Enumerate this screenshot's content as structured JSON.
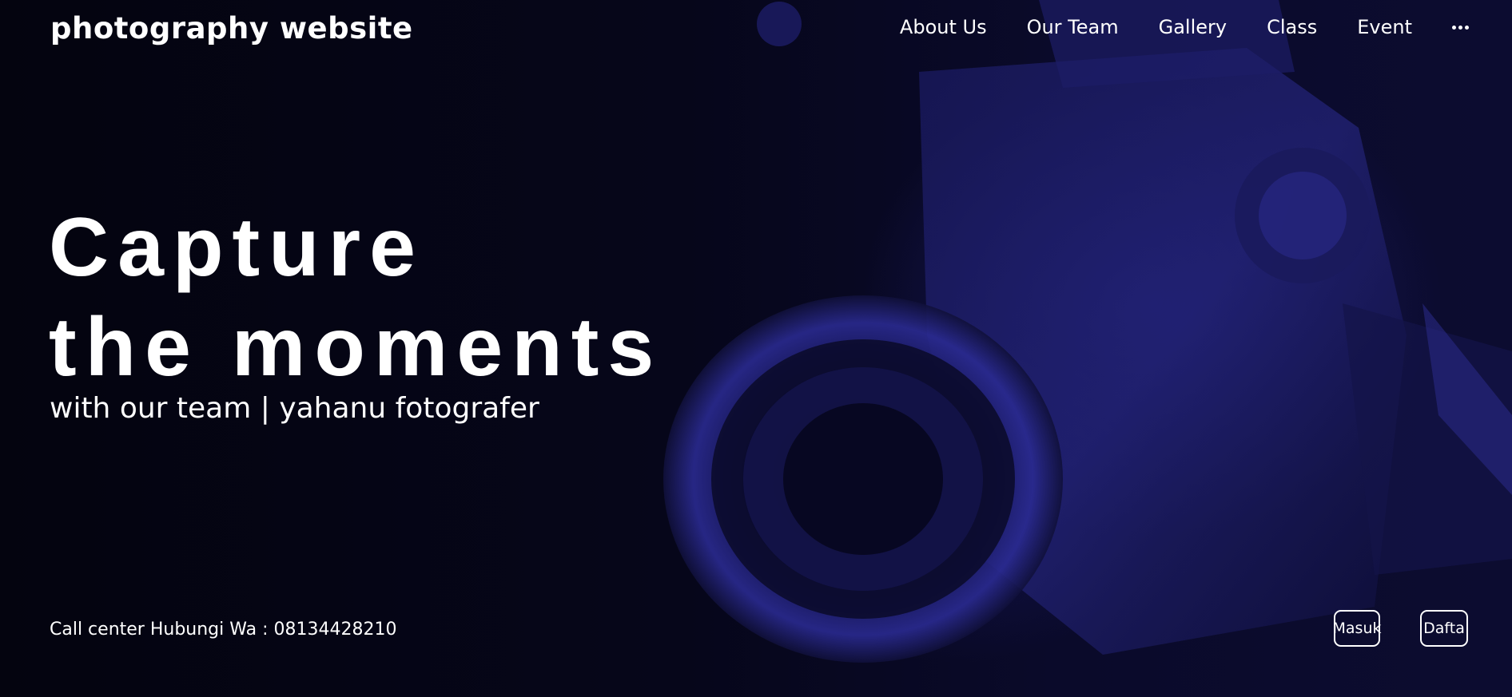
{
  "brand": "photography website",
  "nav": {
    "items": [
      "About Us",
      "Our Team",
      "Gallery",
      "Class",
      "Event"
    ],
    "more_icon": "more-horizontal-icon"
  },
  "hero": {
    "headline_line1": "Capture",
    "headline_line2": "the moments",
    "subtitle": "with our team | yahanu fotografer",
    "background": "camera-photo"
  },
  "footer": {
    "call_center": "Call center Hubungi Wa : 08134428210",
    "login_label": "Masuk",
    "register_label": "Dafta"
  },
  "colors": {
    "background": "#05051a",
    "accent_blue": "#2a2a9a",
    "text": "#ffffff"
  }
}
